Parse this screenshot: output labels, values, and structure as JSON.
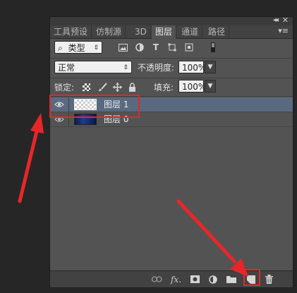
{
  "panel": {
    "tabs": [
      {
        "label": "工具预设"
      },
      {
        "label": "仿制源"
      },
      {
        "label": "3D"
      },
      {
        "label": "图层"
      },
      {
        "label": "通道"
      },
      {
        "label": "路径"
      }
    ],
    "active_tab": "图层"
  },
  "filter": {
    "kind_label": "类型",
    "search_glyph": "⌕"
  },
  "blend": {
    "mode": "正常",
    "opacity_label": "不透明度:",
    "opacity_value": "100%",
    "lock_label": "锁定:",
    "fill_label": "填充:",
    "fill_value": "100%"
  },
  "layers": [
    {
      "name": "图层 1",
      "selected": true,
      "thumb": "transparent"
    },
    {
      "name": "图层 0",
      "selected": false,
      "thumb": "photo"
    }
  ],
  "bottom_icons": [
    "link-icon",
    "fx-icon",
    "mask-icon",
    "adjustment-icon",
    "folder-icon",
    "new-layer-icon",
    "trash-icon"
  ],
  "colors": {
    "panel_bg": "#535353",
    "selected_row": "#596a80",
    "annotation_red": "#e8262a"
  }
}
